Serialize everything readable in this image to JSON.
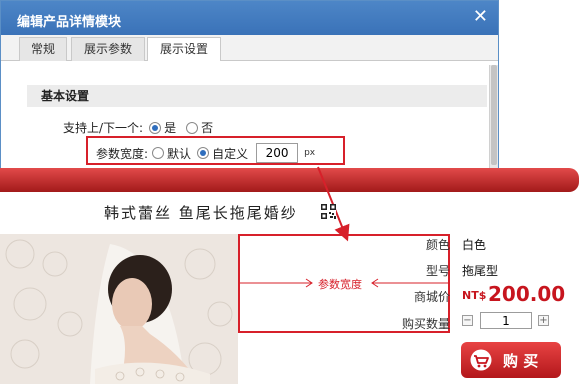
{
  "dialog": {
    "title": "编辑产品详情模块",
    "close_glyph": "✕",
    "tabs": [
      {
        "label": "常规"
      },
      {
        "label": "展示参数"
      },
      {
        "label": "展示设置"
      }
    ],
    "section_title": "基本设置",
    "prev_next_label": "支持上/下一个:",
    "prev_next_options": [
      "是",
      "否"
    ],
    "prev_next_selected": "是",
    "param_width_label": "参数宽度:",
    "param_width_options": [
      "默认",
      "自定义"
    ],
    "param_width_selected": "自定义",
    "param_width_value": "200",
    "param_width_unit": "px"
  },
  "product": {
    "title": "韩式蕾丝 鱼尾长拖尾婚纱",
    "attributes": [
      {
        "label": "颜色",
        "value": "白色"
      },
      {
        "label": "型号",
        "value": "拖尾型"
      }
    ],
    "price_label": "商城价",
    "price_prefix": "NT$",
    "price_value": "200.00",
    "qty_label": "购买数量",
    "qty_value": "1",
    "qty_minus": "−",
    "qty_plus": "+",
    "buy_label": "购 买",
    "annotation_label": "参数宽度"
  },
  "colors": {
    "accent_red": "#d7202a",
    "dialog_blue": "#3a72b8",
    "price_red": "#c7151e"
  },
  "icons": [
    "close-icon",
    "qr-code-icon",
    "cart-icon",
    "annotation-arrow"
  ]
}
